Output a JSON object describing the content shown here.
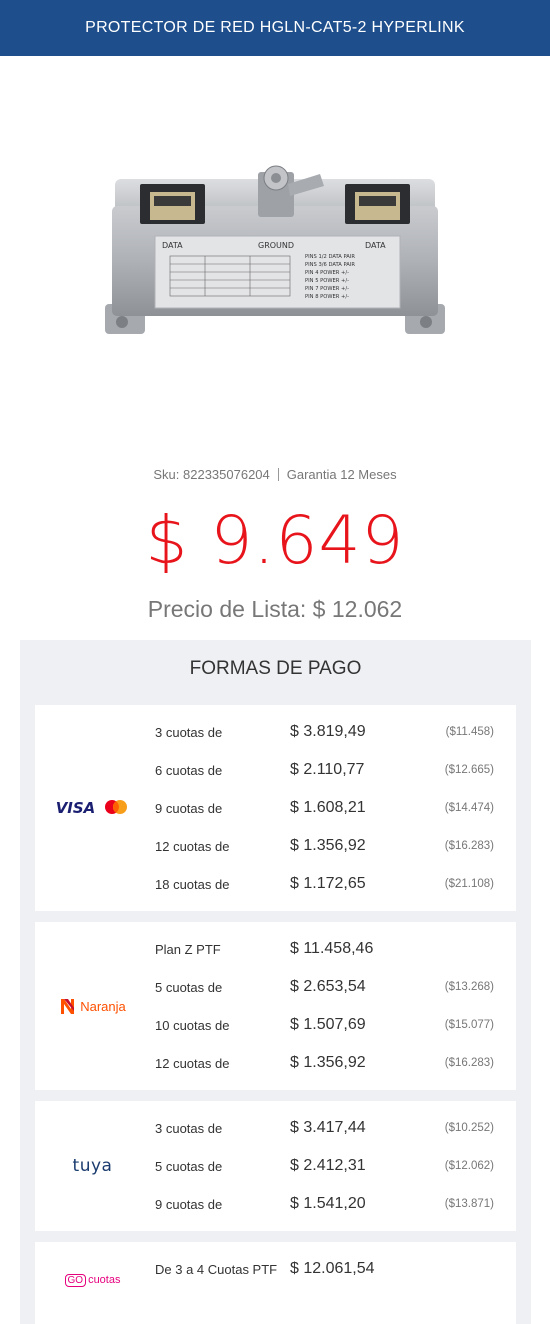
{
  "header": {
    "title": "PROTECTOR DE RED HGLN-CAT5-2 HYPERLINK"
  },
  "product": {
    "image_labels": {
      "data_left": "DATA",
      "ground": "GROUND",
      "data_right": "DATA",
      "pins": [
        "PINS 1/2 DATA PAIR",
        "PINS 3/6 DATA PAIR",
        "PIN 4 POWER +/-",
        "PIN 5 POWER +/-",
        "PIN 7 POWER +/-",
        "PIN 8 POWER +/-"
      ]
    },
    "sku_label": "Sku: 822335076204",
    "warranty": "Garantia 12 Meses",
    "price": "$ 9.649",
    "list_price": "Precio de Lista: $ 12.062"
  },
  "payments": {
    "title": "FORMAS DE PAGO",
    "cards": [
      {
        "logo": "visa-mastercard",
        "logo_text": "VISA",
        "plans": [
          {
            "label": "3 cuotas de",
            "amount": "$ 3.819,49",
            "total": "($11.458)"
          },
          {
            "label": "6 cuotas de",
            "amount": "$ 2.110,77",
            "total": "($12.665)"
          },
          {
            "label": "9 cuotas de",
            "amount": "$ 1.608,21",
            "total": "($14.474)"
          },
          {
            "label": "12 cuotas de",
            "amount": "$ 1.356,92",
            "total": "($16.283)"
          },
          {
            "label": "18 cuotas de",
            "amount": "$ 1.172,65",
            "total": "($21.108)"
          }
        ]
      },
      {
        "logo": "naranja",
        "logo_text": "Naranja",
        "plans": [
          {
            "label": "Plan Z PTF",
            "amount": "$ 11.458,46",
            "total": ""
          },
          {
            "label": "5 cuotas de",
            "amount": "$ 2.653,54",
            "total": "($13.268)"
          },
          {
            "label": "10 cuotas de",
            "amount": "$ 1.507,69",
            "total": "($15.077)"
          },
          {
            "label": "12 cuotas de",
            "amount": "$ 1.356,92",
            "total": "($16.283)"
          }
        ]
      },
      {
        "logo": "tuya",
        "logo_text": "tuya",
        "plans": [
          {
            "label": "3 cuotas de",
            "amount": "$ 3.417,44",
            "total": "($10.252)"
          },
          {
            "label": "5 cuotas de",
            "amount": "$ 2.412,31",
            "total": "($12.062)"
          },
          {
            "label": "9 cuotas de",
            "amount": "$ 1.541,20",
            "total": "($13.871)"
          }
        ]
      },
      {
        "logo": "gocuotas",
        "logo_text_go": "GO",
        "logo_text": "cuotas",
        "plans": [
          {
            "label": "De 3 a 4 Cuotas PTF",
            "amount": "$ 12.061,54",
            "total": ""
          }
        ]
      }
    ]
  },
  "colors": {
    "header_bg": "#1e4f8c",
    "price": "#e8141b",
    "panel_bg": "#eef0f4",
    "naranja": "#ff5000",
    "gocuotas": "#e6007e",
    "tuya": "#1a3b6e"
  }
}
